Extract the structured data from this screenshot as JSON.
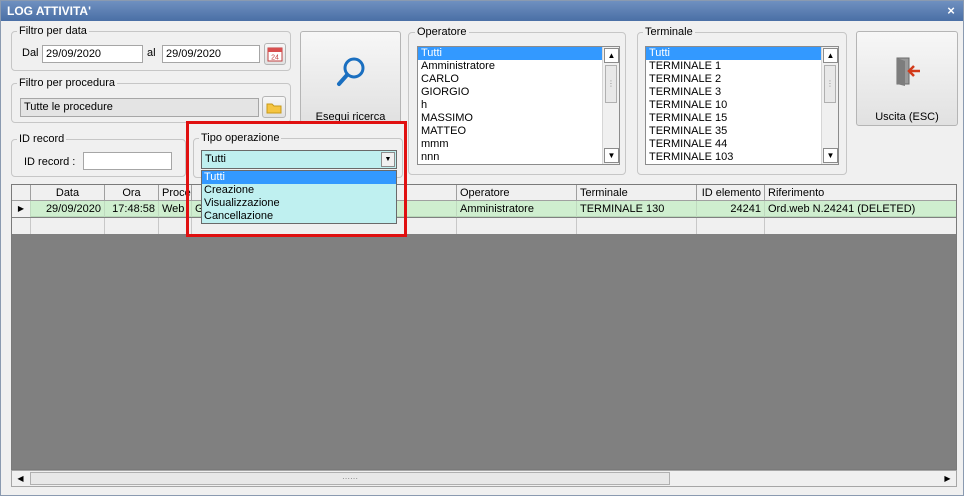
{
  "window": {
    "title": "LOG ATTIVITA'",
    "close_glyph": "×"
  },
  "date_filter": {
    "legend": "Filtro per data",
    "from_label": "Dal",
    "from_value": "29/09/2020",
    "to_label": "al",
    "to_value": "29/09/2020"
  },
  "procedure_filter": {
    "legend": "Filtro per procedura",
    "value": "Tutte le procedure"
  },
  "search_button": {
    "label": "Esegui ricerca",
    "icon": "magnifier-icon"
  },
  "id_record": {
    "legend": "ID record",
    "label": "ID record :",
    "value": ""
  },
  "operation_type": {
    "legend": "Tipo operazione",
    "selected": "Tutti",
    "options": [
      "Tutti",
      "Creazione",
      "Visualizzazione",
      "Cancellazione"
    ]
  },
  "operator": {
    "legend": "Operatore",
    "items": [
      "Tutti",
      "Amministratore",
      "CARLO",
      "GIORGIO",
      "h",
      "MASSIMO",
      "MATTEO",
      "mmm",
      "nnn"
    ]
  },
  "terminal": {
    "legend": "Terminale",
    "items": [
      "Tutti",
      "TERMINALE 1",
      "TERMINALE 2",
      "TERMINALE 3",
      "TERMINALE 10",
      "TERMINALE 15",
      "TERMINALE 35",
      "TERMINALE 44",
      "TERMINALE 103"
    ]
  },
  "exit_button": {
    "label": "Uscita (ESC)",
    "icon": "exit-door-icon"
  },
  "grid": {
    "columns": [
      "Data",
      "Ora",
      "Procedura",
      "",
      "Operatore",
      "Terminale",
      "ID elemento",
      "Riferimento"
    ],
    "rows": [
      {
        "data": "29/09/2020",
        "ora": "17:48:58",
        "procedura": "Web",
        "extra": "G",
        "operatore": "Amministratore",
        "terminale": "TERMINALE 130",
        "id": "24241",
        "riferimento": "Ord.web N.24241 (DELETED)"
      }
    ],
    "row_indicator": "▶"
  },
  "colors": {
    "accent": "#3399ff",
    "highlight_border": "#e01010",
    "row_green": "#cfeecf",
    "dropdown_bg": "#bff0f0"
  }
}
